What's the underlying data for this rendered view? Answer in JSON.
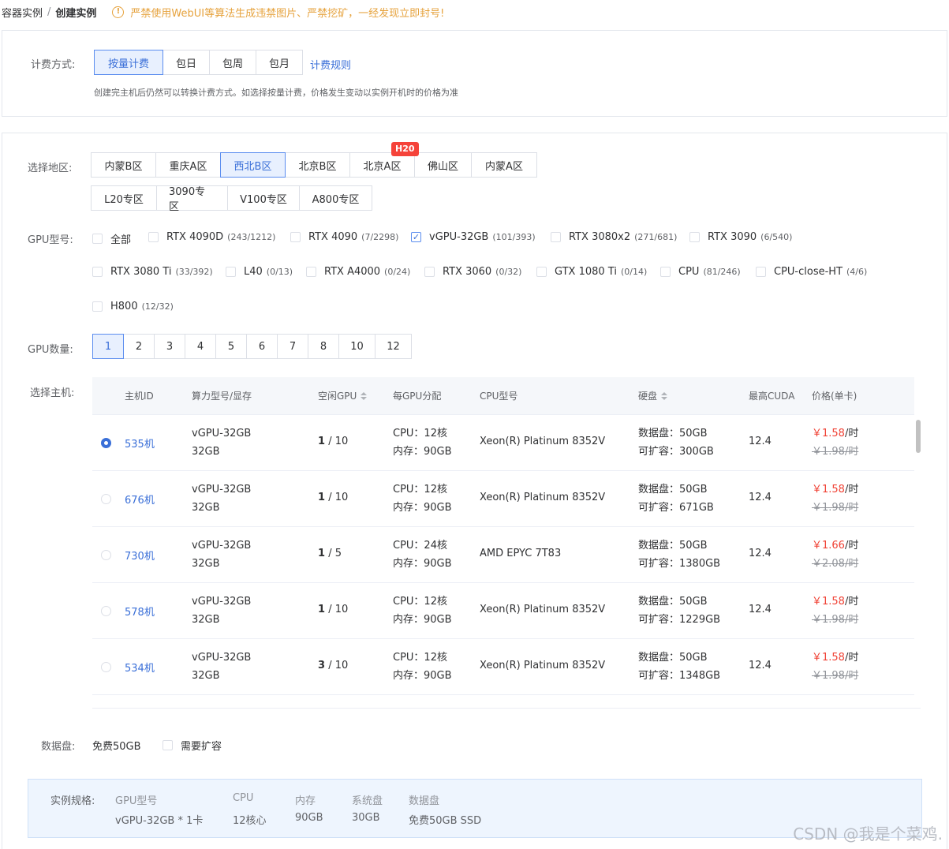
{
  "breadcrumb": {
    "parent": "容器实例",
    "separator": "/",
    "current": "创建实例"
  },
  "warning": {
    "icon": "exclamation-circle-icon",
    "text": "严禁使用WebUI等算法生成违禁图片、严禁挖矿，一经发现立即封号!"
  },
  "billing": {
    "label": "计费方式:",
    "options": [
      "按量计费",
      "包日",
      "包周",
      "包月"
    ],
    "selected": "按量计费",
    "rules_link": "计费规则",
    "hint": "创建完主机后仍然可以转换计费方式。如选择按量计费，价格发生变动以实例开机时的价格为准"
  },
  "region": {
    "label": "选择地区:",
    "row1": [
      "内蒙B区",
      "重庆A区",
      "西北B区",
      "北京B区",
      "北京A区",
      "佛山区",
      "内蒙A区"
    ],
    "row2": [
      "L20专区",
      "3090专区",
      "V100专区",
      "A800专区"
    ],
    "selected": "西北B区",
    "badge": "H20"
  },
  "gpu_model": {
    "label": "GPU型号:",
    "items": [
      {
        "name": "全部",
        "count": "",
        "checked": false
      },
      {
        "name": "RTX 4090D",
        "count": "(243/1212)",
        "checked": false
      },
      {
        "name": "RTX 4090",
        "count": "(7/2298)",
        "checked": false
      },
      {
        "name": "vGPU-32GB",
        "count": "(101/393)",
        "checked": true
      },
      {
        "name": "RTX 3080x2",
        "count": "(271/681)",
        "checked": false
      },
      {
        "name": "RTX 3090",
        "count": "(6/540)",
        "checked": false
      },
      {
        "name": "RTX 3080 Ti",
        "count": "(33/392)",
        "checked": false
      },
      {
        "name": "L40",
        "count": "(0/13)",
        "checked": false
      },
      {
        "name": "RTX A4000",
        "count": "(0/24)",
        "checked": false
      },
      {
        "name": "RTX 3060",
        "count": "(0/32)",
        "checked": false
      },
      {
        "name": "GTX 1080 Ti",
        "count": "(0/14)",
        "checked": false
      },
      {
        "name": "CPU",
        "count": "(81/246)",
        "checked": false
      },
      {
        "name": "CPU-close-HT",
        "count": "(4/6)",
        "checked": false
      },
      {
        "name": "H800",
        "count": "(12/32)",
        "checked": false
      }
    ]
  },
  "gpu_count": {
    "label": "GPU数量:",
    "options": [
      "1",
      "2",
      "3",
      "4",
      "5",
      "6",
      "7",
      "8",
      "10",
      "12"
    ],
    "selected": "1"
  },
  "host_select": {
    "label": "选择主机:",
    "columns": [
      "主机ID",
      "算力型号/显存",
      "空闲GPU",
      "每GPU分配",
      "CPU型号",
      "硬盘",
      "最高CUDA",
      "价格(单卡)"
    ],
    "rows": [
      {
        "id": "535机",
        "model": "vGPU-32GB",
        "vram": "32GB",
        "free": "1",
        "total": "/ 10",
        "cpu": "CPU：12核",
        "mem": "内存：90GB",
        "cpu_model": "Xeon(R) Platinum 8352V",
        "disk": "数据盘：50GB",
        "expand": "可扩容：300GB",
        "cuda": "12.4",
        "price": "￥1.58",
        "unit": "/时",
        "old_price": "￥1.98/时",
        "selected": true
      },
      {
        "id": "676机",
        "model": "vGPU-32GB",
        "vram": "32GB",
        "free": "1",
        "total": "/ 10",
        "cpu": "CPU：12核",
        "mem": "内存：90GB",
        "cpu_model": "Xeon(R) Platinum 8352V",
        "disk": "数据盘：50GB",
        "expand": "可扩容：671GB",
        "cuda": "12.4",
        "price": "￥1.58",
        "unit": "/时",
        "old_price": "￥1.98/时",
        "selected": false
      },
      {
        "id": "730机",
        "model": "vGPU-32GB",
        "vram": "32GB",
        "free": "1",
        "total": "/ 5",
        "cpu": "CPU：24核",
        "mem": "内存：90GB",
        "cpu_model": "AMD EPYC 7T83",
        "disk": "数据盘：50GB",
        "expand": "可扩容：1380GB",
        "cuda": "12.4",
        "price": "￥1.66",
        "unit": "/时",
        "old_price": "￥2.08/时",
        "selected": false
      },
      {
        "id": "578机",
        "model": "vGPU-32GB",
        "vram": "32GB",
        "free": "1",
        "total": "/ 10",
        "cpu": "CPU：12核",
        "mem": "内存：90GB",
        "cpu_model": "Xeon(R) Platinum 8352V",
        "disk": "数据盘：50GB",
        "expand": "可扩容：1229GB",
        "cuda": "12.4",
        "price": "￥1.58",
        "unit": "/时",
        "old_price": "￥1.98/时",
        "selected": false
      },
      {
        "id": "534机",
        "model": "vGPU-32GB",
        "vram": "32GB",
        "free": "3",
        "total": "/ 10",
        "cpu": "CPU：12核",
        "mem": "内存：90GB",
        "cpu_model": "Xeon(R) Platinum 8352V",
        "disk": "数据盘：50GB",
        "expand": "可扩容：1348GB",
        "cuda": "12.4",
        "price": "￥1.58",
        "unit": "/时",
        "old_price": "￥1.98/时",
        "selected": false
      }
    ]
  },
  "data_disk": {
    "label": "数据盘:",
    "free": "免费50GB",
    "expand_option": "需要扩容"
  },
  "spec": {
    "title": "实例规格:",
    "keys": [
      "GPU型号",
      "CPU",
      "内存",
      "系统盘",
      "数据盘"
    ],
    "values": [
      "vGPU-32GB * 1卡",
      "12核心",
      "90GB",
      "30GB",
      "免费50GB SSD"
    ]
  },
  "watermark": "CSDN @我是个菜鸡.",
  "colors": {
    "accent": "#3a6fd8",
    "warning": "#e6a23c",
    "price": "#f04134",
    "badge": "#f5433a"
  }
}
